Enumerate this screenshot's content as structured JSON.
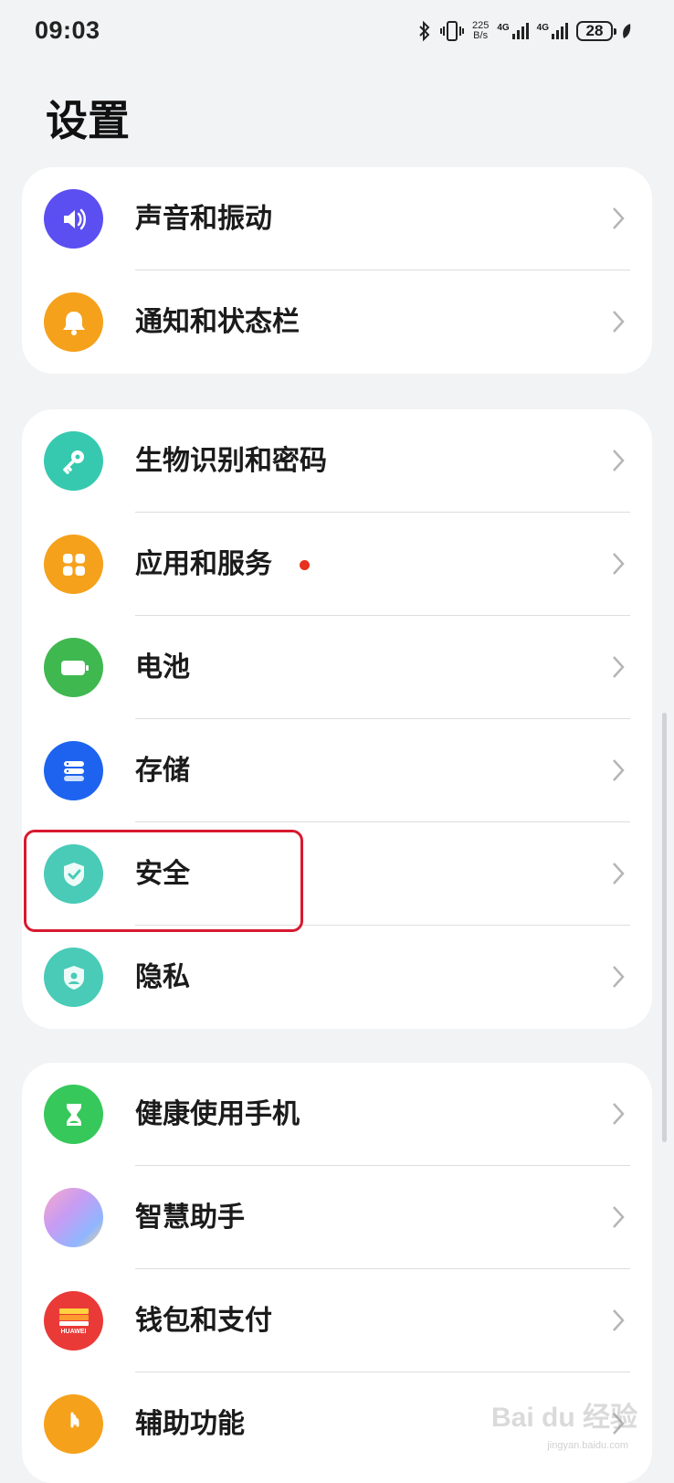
{
  "status_bar": {
    "time": "09:03",
    "net_speed_value": "225",
    "net_speed_unit": "B/s",
    "network_type_1": "4G",
    "network_type_2": "4G",
    "battery_level": "28"
  },
  "page_title": "设置",
  "groups": [
    {
      "items": [
        {
          "label": "声音和振动",
          "icon": "sound-icon",
          "color": "#5b4ff2"
        },
        {
          "label": "通知和状态栏",
          "icon": "bell-icon",
          "color": "#f5a11b"
        }
      ]
    },
    {
      "items": [
        {
          "label": "生物识别和密码",
          "icon": "key-icon",
          "color": "#36c9b0"
        },
        {
          "label": "应用和服务",
          "icon": "apps-icon",
          "color": "#f5a11b",
          "badge": "red-dot"
        },
        {
          "label": "电池",
          "icon": "battery-icon",
          "color": "#3fb850"
        },
        {
          "label": "存储",
          "icon": "storage-icon",
          "color": "#1e63f0"
        },
        {
          "label": "安全",
          "icon": "shield-check-icon",
          "color": "#49cbb7"
        },
        {
          "label": "隐私",
          "icon": "privacy-icon",
          "color": "#49cbb7"
        }
      ]
    },
    {
      "items": [
        {
          "label": "健康使用手机",
          "icon": "hourglass-icon",
          "color": "#36c85a"
        },
        {
          "label": "智慧助手",
          "icon": "assistant-icon",
          "color": "#b48cf2"
        },
        {
          "label": "钱包和支付",
          "icon": "wallet-icon",
          "color": "#ea3a37"
        },
        {
          "label": "辅助功能",
          "icon": "accessibility-icon",
          "color": "#f5a11b"
        }
      ]
    }
  ],
  "wallet_icon_text": "HUAWEI",
  "watermark": {
    "text": "Bai du 经验",
    "sub": "jingyan.baidu.com"
  }
}
